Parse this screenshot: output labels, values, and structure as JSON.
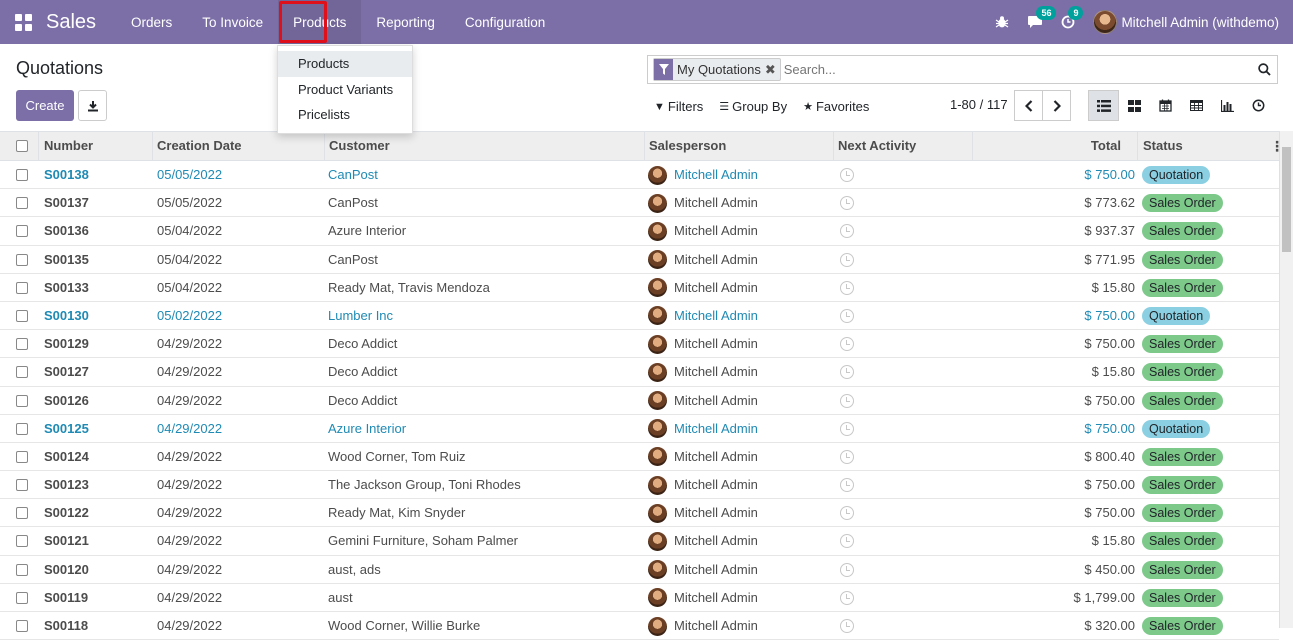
{
  "nav": {
    "brand": "Sales",
    "menu": [
      "Orders",
      "To Invoice",
      "Products",
      "Reporting",
      "Configuration"
    ],
    "active_menu": "Products",
    "messages_count": "56",
    "activities_count": "9",
    "user": "Mitchell Admin (withdemo)"
  },
  "dropdown": {
    "items": [
      "Products",
      "Product Variants",
      "Pricelists"
    ],
    "focused": "Products"
  },
  "page": {
    "title": "Quotations",
    "create_label": "Create"
  },
  "search": {
    "facet": "My Quotations",
    "placeholder": "Search..."
  },
  "filters": {
    "filters_label": "Filters",
    "groupby_label": "Group By",
    "favorites_label": "Favorites"
  },
  "pager": {
    "range": "1-80 / 117"
  },
  "views": [
    "list-view-icon",
    "kanban-view-icon",
    "calendar-view-icon",
    "pivot-view-icon",
    "graph-view-icon",
    "activity-view-icon"
  ],
  "table": {
    "columns": [
      "Number",
      "Creation Date",
      "Customer",
      "Salesperson",
      "Next Activity",
      "Total",
      "Status"
    ],
    "rows": [
      {
        "number": "S00138",
        "date": "05/05/2022",
        "customer": "CanPost",
        "salesperson": "Mitchell Admin",
        "total": "$ 750.00",
        "status": "Quotation"
      },
      {
        "number": "S00137",
        "date": "05/05/2022",
        "customer": "CanPost",
        "salesperson": "Mitchell Admin",
        "total": "$ 773.62",
        "status": "Sales Order"
      },
      {
        "number": "S00136",
        "date": "05/04/2022",
        "customer": "Azure Interior",
        "salesperson": "Mitchell Admin",
        "total": "$ 937.37",
        "status": "Sales Order"
      },
      {
        "number": "S00135",
        "date": "05/04/2022",
        "customer": "CanPost",
        "salesperson": "Mitchell Admin",
        "total": "$ 771.95",
        "status": "Sales Order"
      },
      {
        "number": "S00133",
        "date": "05/04/2022",
        "customer": "Ready Mat, Travis Mendoza",
        "salesperson": "Mitchell Admin",
        "total": "$ 15.80",
        "status": "Sales Order"
      },
      {
        "number": "S00130",
        "date": "05/02/2022",
        "customer": "Lumber Inc",
        "salesperson": "Mitchell Admin",
        "total": "$ 750.00",
        "status": "Quotation"
      },
      {
        "number": "S00129",
        "date": "04/29/2022",
        "customer": "Deco Addict",
        "salesperson": "Mitchell Admin",
        "total": "$ 750.00",
        "status": "Sales Order"
      },
      {
        "number": "S00127",
        "date": "04/29/2022",
        "customer": "Deco Addict",
        "salesperson": "Mitchell Admin",
        "total": "$ 15.80",
        "status": "Sales Order"
      },
      {
        "number": "S00126",
        "date": "04/29/2022",
        "customer": "Deco Addict",
        "salesperson": "Mitchell Admin",
        "total": "$ 750.00",
        "status": "Sales Order"
      },
      {
        "number": "S00125",
        "date": "04/29/2022",
        "customer": "Azure Interior",
        "salesperson": "Mitchell Admin",
        "total": "$ 750.00",
        "status": "Quotation"
      },
      {
        "number": "S00124",
        "date": "04/29/2022",
        "customer": "Wood Corner, Tom Ruiz",
        "salesperson": "Mitchell Admin",
        "total": "$ 800.40",
        "status": "Sales Order"
      },
      {
        "number": "S00123",
        "date": "04/29/2022",
        "customer": "The Jackson Group, Toni Rhodes",
        "salesperson": "Mitchell Admin",
        "total": "$ 750.00",
        "status": "Sales Order"
      },
      {
        "number": "S00122",
        "date": "04/29/2022",
        "customer": "Ready Mat, Kim Snyder",
        "salesperson": "Mitchell Admin",
        "total": "$ 750.00",
        "status": "Sales Order"
      },
      {
        "number": "S00121",
        "date": "04/29/2022",
        "customer": "Gemini Furniture, Soham Palmer",
        "salesperson": "Mitchell Admin",
        "total": "$ 15.80",
        "status": "Sales Order"
      },
      {
        "number": "S00120",
        "date": "04/29/2022",
        "customer": "aust, ads",
        "salesperson": "Mitchell Admin",
        "total": "$ 450.00",
        "status": "Sales Order"
      },
      {
        "number": "S00119",
        "date": "04/29/2022",
        "customer": "aust",
        "salesperson": "Mitchell Admin",
        "total": "$ 1,799.00",
        "status": "Sales Order"
      },
      {
        "number": "S00118",
        "date": "04/29/2022",
        "customer": "Wood Corner, Willie Burke",
        "salesperson": "Mitchell Admin",
        "total": "$ 320.00",
        "status": "Sales Order"
      }
    ]
  },
  "colors": {
    "brand": "#7c6fa7",
    "link": "#1f8ab4",
    "quotation_badge": "#8ad0e2",
    "sales_order_badge": "#7cc98a",
    "highlight": "#e0101b"
  }
}
